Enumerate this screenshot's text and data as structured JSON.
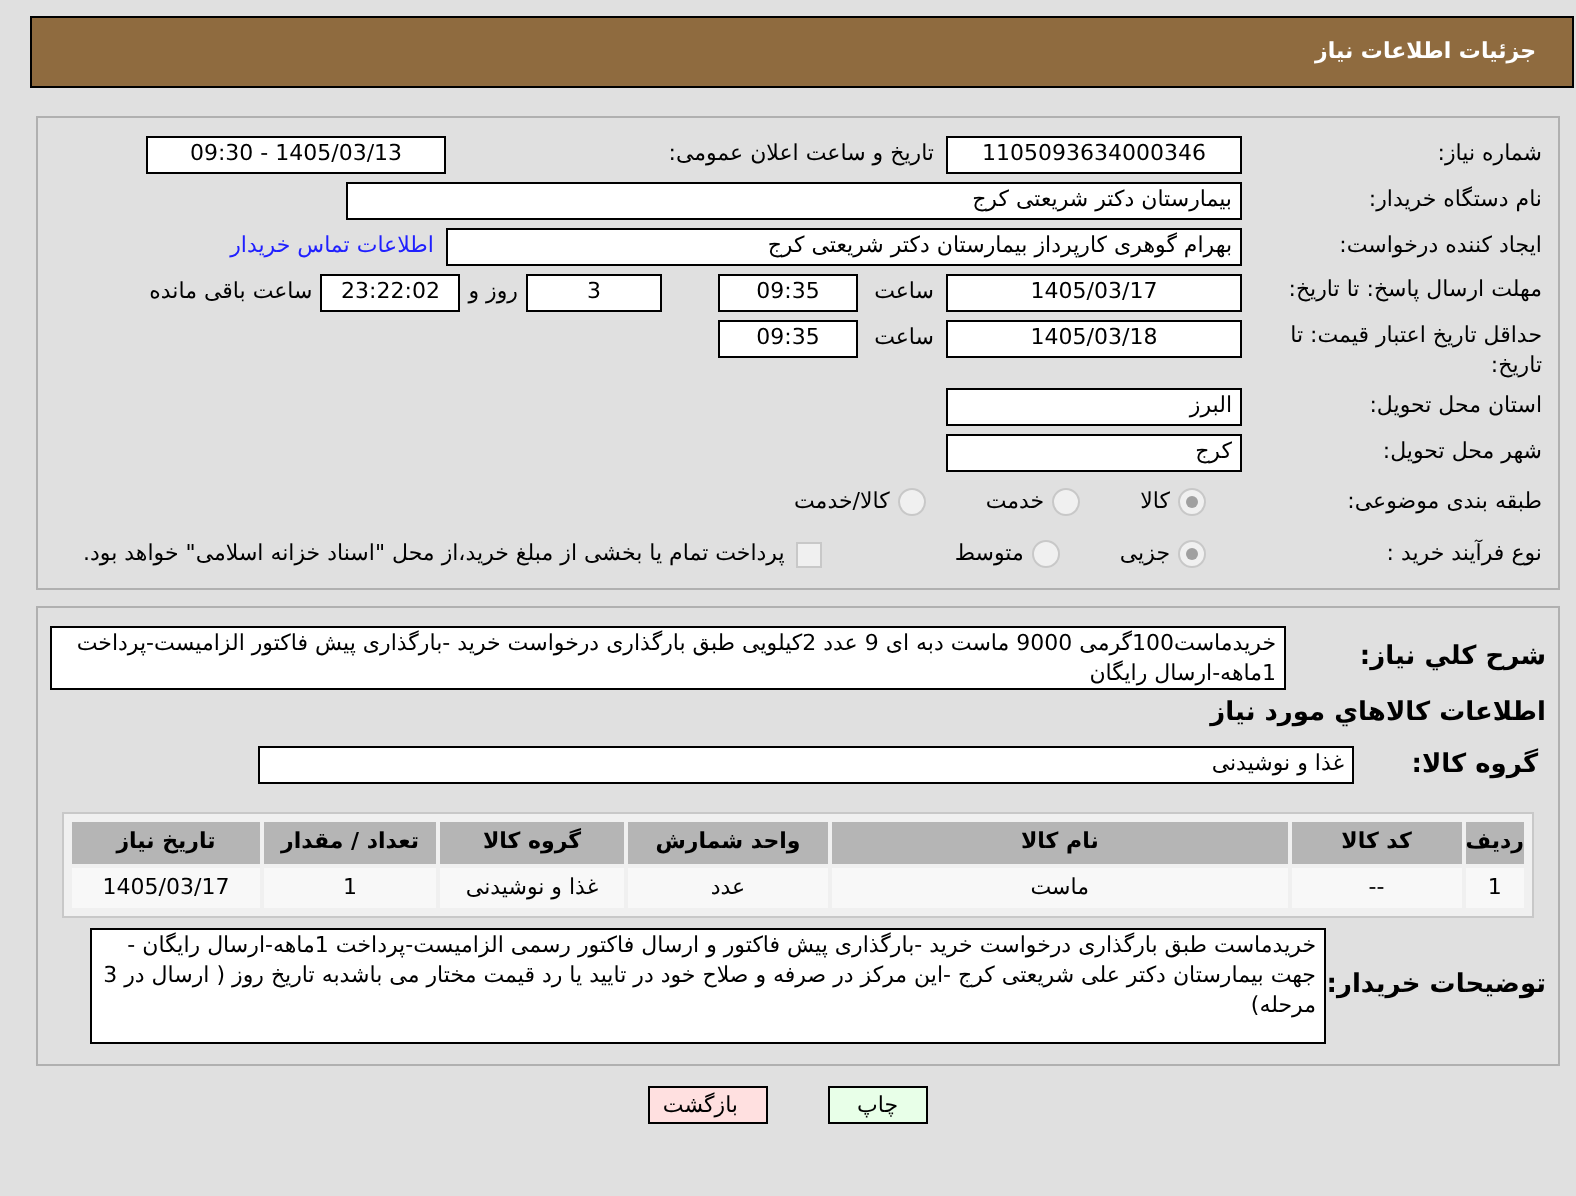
{
  "header": {
    "title": "جزئیات اطلاعات نیاز"
  },
  "need_number": {
    "label": "شماره نیاز:",
    "value": "1105093634000346"
  },
  "announce": {
    "label": "تاریخ و ساعت اعلان عمومی:",
    "value": "1405/03/13 - 09:30"
  },
  "buyer_org": {
    "label": "نام دستگاه خریدار:",
    "value": "بیمارستان دکتر شریعتی کرج"
  },
  "requester": {
    "label": "ایجاد کننده درخواست:",
    "value": "بهرام گوهری کارپرداز بیمارستان دکتر شریعتی کرج",
    "link": "اطلاعات تماس خریدار"
  },
  "deadline": {
    "label": "مهلت ارسال پاسخ: تا تاریخ:",
    "date": "1405/03/17",
    "time_label": "ساعت",
    "time": "09:35",
    "days": "3",
    "days_label": "روز و",
    "remaining": "23:22:02",
    "remaining_label": "ساعت باقی مانده"
  },
  "validity": {
    "label": "حداقل تاریخ اعتبار قیمت: تا تاریخ:",
    "date": "1405/03/18",
    "time_label": "ساعت",
    "time": "09:35"
  },
  "province": {
    "label": "استان محل تحویل:",
    "value": "البرز"
  },
  "city": {
    "label": "شهر محل تحویل:",
    "value": "کرج"
  },
  "category": {
    "label": "طبقه بندی موضوعی:",
    "options": [
      {
        "label": "کالا",
        "selected": true
      },
      {
        "label": "خدمت",
        "selected": false
      },
      {
        "label": "کالا/خدمت",
        "selected": false
      }
    ]
  },
  "process": {
    "label": "نوع فرآیند خرید :",
    "options": [
      {
        "label": "جزیی",
        "selected": true
      },
      {
        "label": "متوسط",
        "selected": false
      }
    ],
    "checkbox": {
      "label": "پرداخت تمام یا بخشی از مبلغ خرید،از محل \"اسناد خزانه اسلامی\" خواهد بود.",
      "checked": false
    }
  },
  "description": {
    "label": "شرح کلي نياز:",
    "value": "خریدماست100گرمی 9000 ماست دبه ای 9 عدد 2کیلویی طبق بارگذاری درخواست خرید -بارگذاری پیش فاکتور  الزامیست-پرداخت 1ماهه-ارسال رایگان"
  },
  "goods_section": {
    "title": "اطلاعات کالاهاي مورد نياز"
  },
  "goods_group": {
    "label": "گروه کالا:",
    "value": "غذا و نوشیدنی"
  },
  "table": {
    "columns": [
      "ردیف",
      "کد کالا",
      "نام کالا",
      "واحد شمارش",
      "گروه کالا",
      "تعداد / مقدار",
      "تاریخ نیاز"
    ],
    "rows": [
      [
        "1",
        "--",
        "ماست",
        "عدد",
        "غذا و نوشیدنی",
        "1",
        "1405/03/17"
      ]
    ]
  },
  "buyer_notes": {
    "label": "توضیحات خریدار:",
    "value": "خریدماست  طبق بارگذاری درخواست خرید -بارگذاری پیش فاکتور و ارسال فاکتور رسمی الزامیست-پرداخت 1ماهه-ارسال رایگان - جهت بیمارستان دکتر علی شریعتی کرج -این مرکز در صرفه و صلاح خود در تایید یا رد قیمت مختار می باشدبه تاریخ روز ( ارسال در 3 مرحله)"
  },
  "buttons": [
    {
      "label": "چاپ",
      "kind": "print"
    },
    {
      "label": "بازگشت",
      "kind": "back"
    }
  ]
}
